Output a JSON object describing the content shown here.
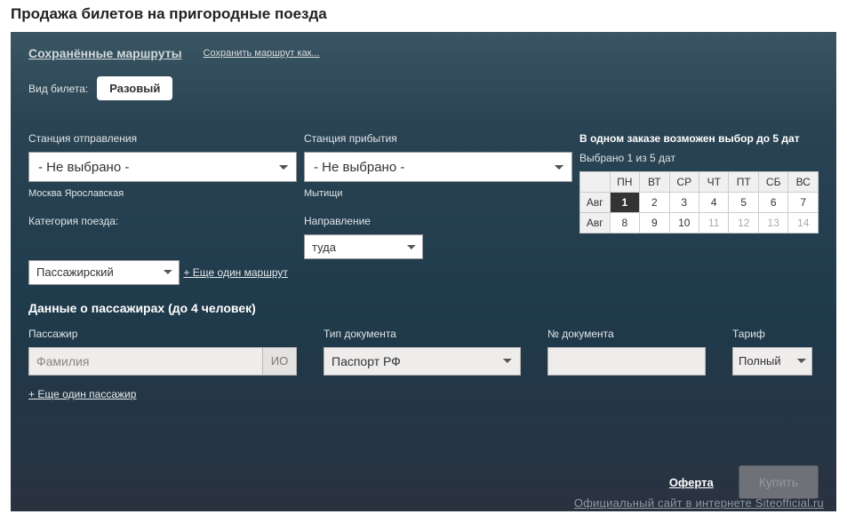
{
  "page_title": "Продажа билетов на пригородные поезда",
  "top": {
    "saved_routes": "Сохранённые маршруты",
    "save_as": "Сохранить маршрут как...",
    "ticket_type_label": "Вид билета:",
    "ticket_type_value": "Разовый"
  },
  "departure": {
    "label": "Станция отправления",
    "value": "- Не выбрано -",
    "hint": "Москва Ярославская"
  },
  "arrival": {
    "label": "Станция прибытия",
    "value": "- Не выбрано -",
    "hint": "Мытищи"
  },
  "category": {
    "label": "Категория поезда:",
    "value": "Пассажирский"
  },
  "direction": {
    "label": "Направление",
    "value": "туда"
  },
  "dates": {
    "note": "В одном заказе возможен выбор до 5 дат",
    "selected_text": "Выбрано 1 из 5 дат",
    "weekdays": [
      "ПН",
      "ВТ",
      "СР",
      "ЧТ",
      "ПТ",
      "СБ",
      "ВС"
    ],
    "month_short": "Авг",
    "rows": [
      {
        "days": [
          1,
          2,
          3,
          4,
          5,
          6,
          7
        ],
        "selected": 0
      },
      {
        "days": [
          8,
          9,
          10,
          11,
          12,
          13,
          14
        ],
        "disabled_from": 3
      }
    ]
  },
  "add_route": "+ Еще один маршрут",
  "pax": {
    "title": "Данные о пассажирах (до 4 человек)",
    "passenger_label": "Пассажир",
    "surname_placeholder": "Фамилия",
    "io_label": "ИО",
    "doc_type_label": "Тип документа",
    "doc_type_value": "Паспорт РФ",
    "doc_num_label": "№ документа",
    "tariff_label": "Тариф",
    "tariff_value": "Полный"
  },
  "add_pax": "+ Еще один пассажир",
  "offer": "Оферта",
  "buy": "Купить",
  "watermark": "Официальный сайт в интернете Siteofficial.ru"
}
